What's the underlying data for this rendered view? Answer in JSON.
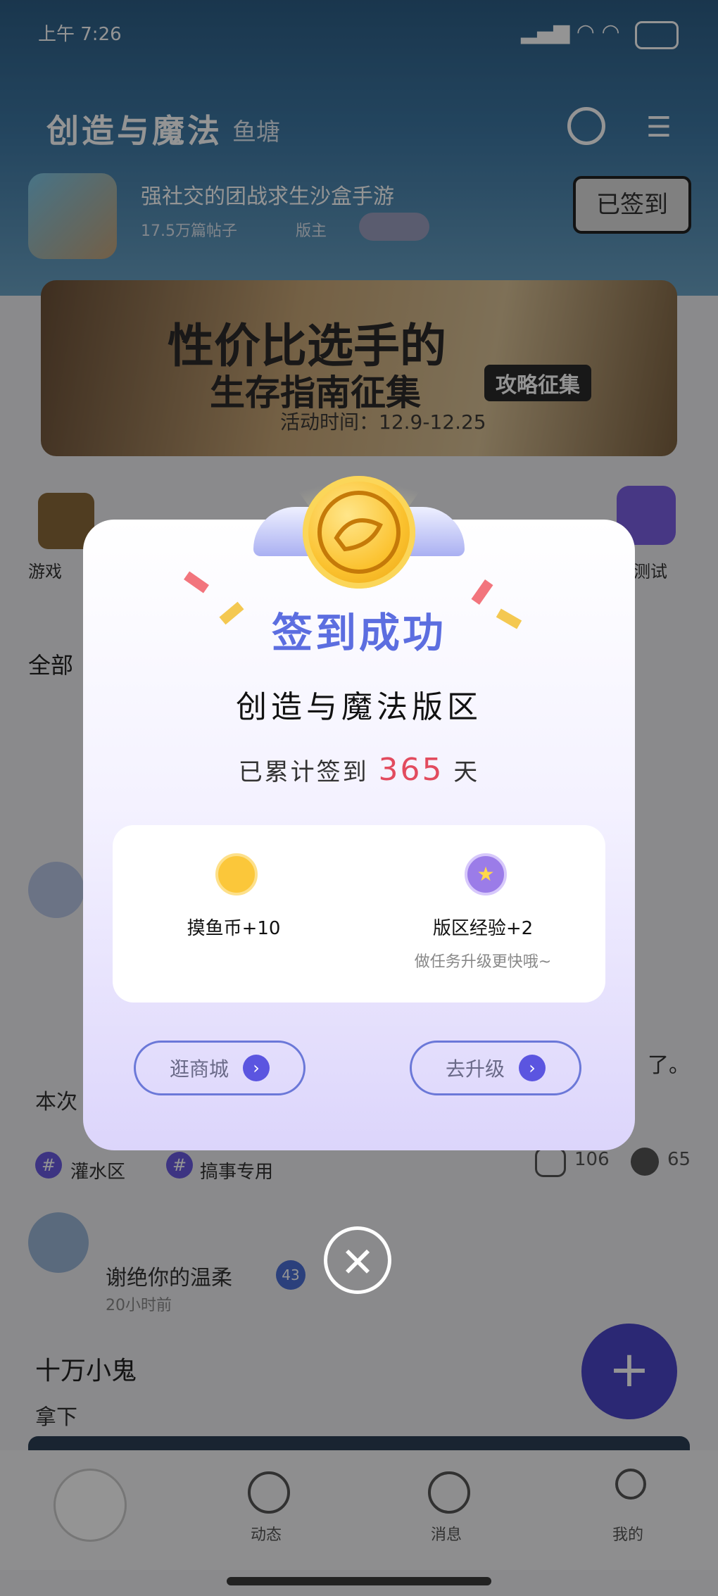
{
  "status_bar": {
    "time": "上午 7:26"
  },
  "header": {
    "title": "创造与魔法",
    "subtitle": "鱼塘",
    "community_desc": "强社交的团战求生沙盒手游",
    "posts": "17.5万篇帖子",
    "owner_label": "版主",
    "checkin_button": "已签到"
  },
  "banner": {
    "line1": "性价比选手的",
    "line2": "生存指南征集",
    "tag": "攻略征集",
    "period": "活动时间：12.9-12.25"
  },
  "background_feed": {
    "icon_labels": [
      "游戏",
      "测试"
    ],
    "post1_snippet": "本次",
    "post1_tail": "了。",
    "tags": [
      "灌水区",
      "搞事专用"
    ],
    "comments": "106",
    "likes": "65",
    "post2_author": "谢绝你的温柔",
    "post2_time": "20小时前",
    "post2_level": "43",
    "post2_title": "十万小鬼",
    "post2_body": "拿下"
  },
  "bottom_nav": [
    "动态",
    "消息",
    "我的"
  ],
  "modal": {
    "title": "签到成功",
    "zone_name": "创造与魔法版区",
    "days_prefix": "已累计签到",
    "days_count": "365",
    "days_suffix": "天",
    "reward1": "摸鱼币+10",
    "reward2": "版区经验+2",
    "reward2_tip": "做任务升级更快哦~",
    "btn_shop": "逛商城",
    "btn_upgrade": "去升级"
  },
  "colors": {
    "accent": "#5b55e0",
    "success_title": "#5c6ee0",
    "days": "#e24b5e"
  }
}
